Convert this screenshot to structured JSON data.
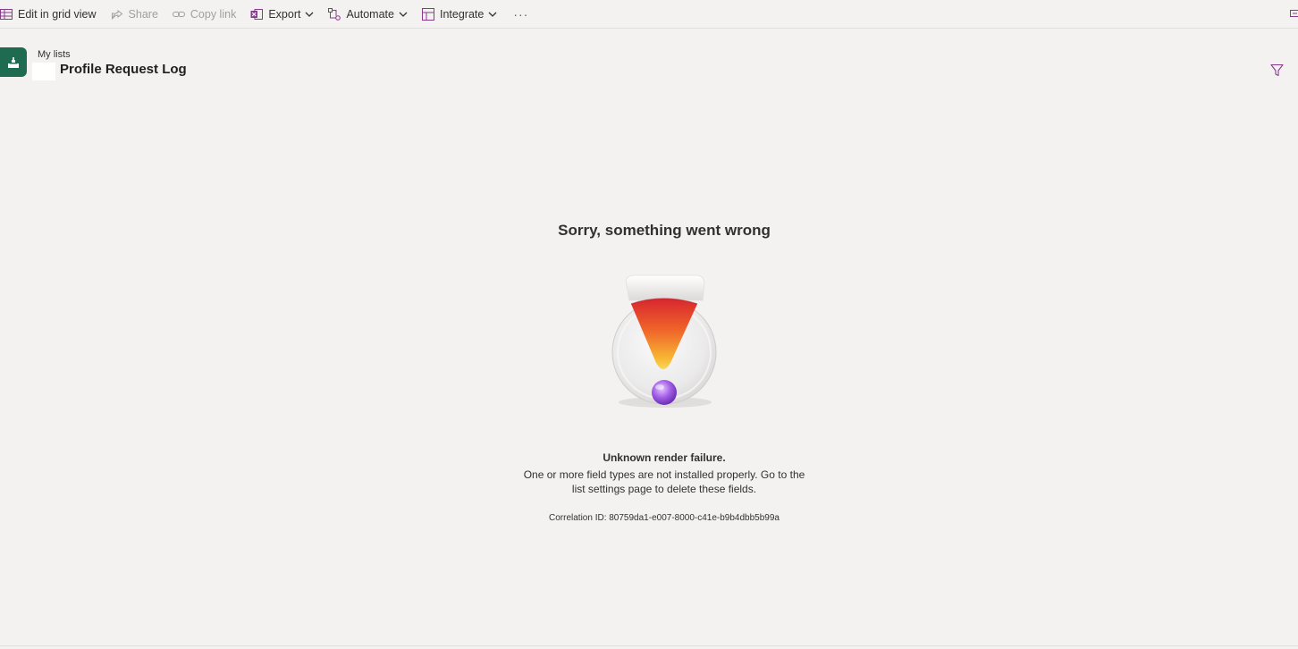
{
  "commandbar": {
    "edit_grid": "Edit in grid view",
    "share": "Share",
    "copy_link": "Copy link",
    "export": "Export",
    "automate": "Automate",
    "integrate": "Integrate",
    "more": "···"
  },
  "header": {
    "breadcrumb": "My lists",
    "title": "Profile Request Log"
  },
  "error": {
    "title": "Sorry, something went wrong",
    "subtitle": "Unknown render failure.",
    "message": "One or more field types are not installed properly. Go to the list settings page to delete these fields.",
    "correlation": "Correlation ID: 80759da1-e007-8000-c41e-b9b4dbb5b99a"
  },
  "colors": {
    "accent": "#8a3a8c",
    "logo": "#1e6b52",
    "background": "#f3f2f1"
  },
  "icons": [
    "grid-icon",
    "share-icon",
    "link-icon",
    "excel-icon",
    "automate-icon",
    "integrate-icon",
    "chevron-down-icon",
    "filter-icon",
    "list-icon"
  ]
}
